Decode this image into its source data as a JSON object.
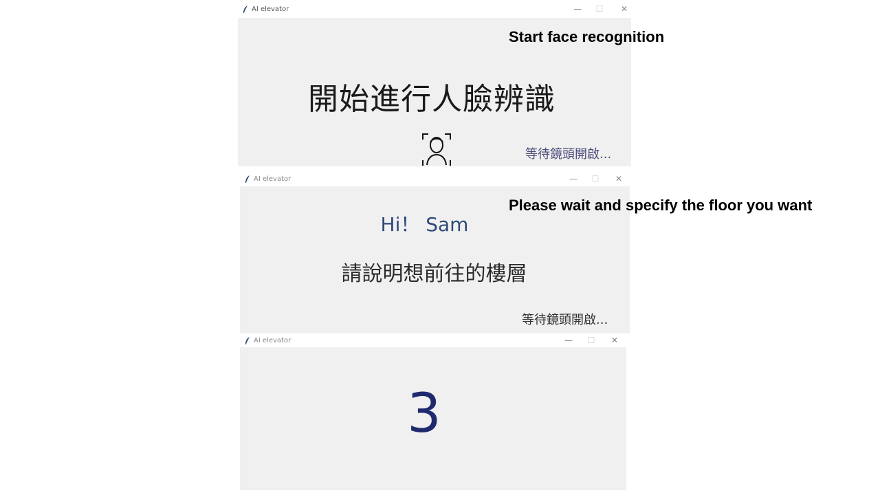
{
  "captions": {
    "start": "Start face recognition",
    "wait": "Please wait and specify the floor you want"
  },
  "windows": [
    {
      "title": "AI elevator",
      "heading": "開始進行人臉辨識",
      "status": "等待鏡頭開啟...",
      "icon": "face-scan-icon"
    },
    {
      "title": "AI elevator",
      "greeting": "Hi！ Sam",
      "prompt": "請說明想前往的樓層",
      "status": "等待鏡頭開啟..."
    },
    {
      "title": "AI elevator",
      "floor": "3"
    }
  ],
  "colors": {
    "background": "#f0f0f0",
    "title_bar": "#ffffff",
    "greeting": "#2e4a7a",
    "status_first": "#4a4a7a",
    "floor_number": "#1f2a6e"
  }
}
